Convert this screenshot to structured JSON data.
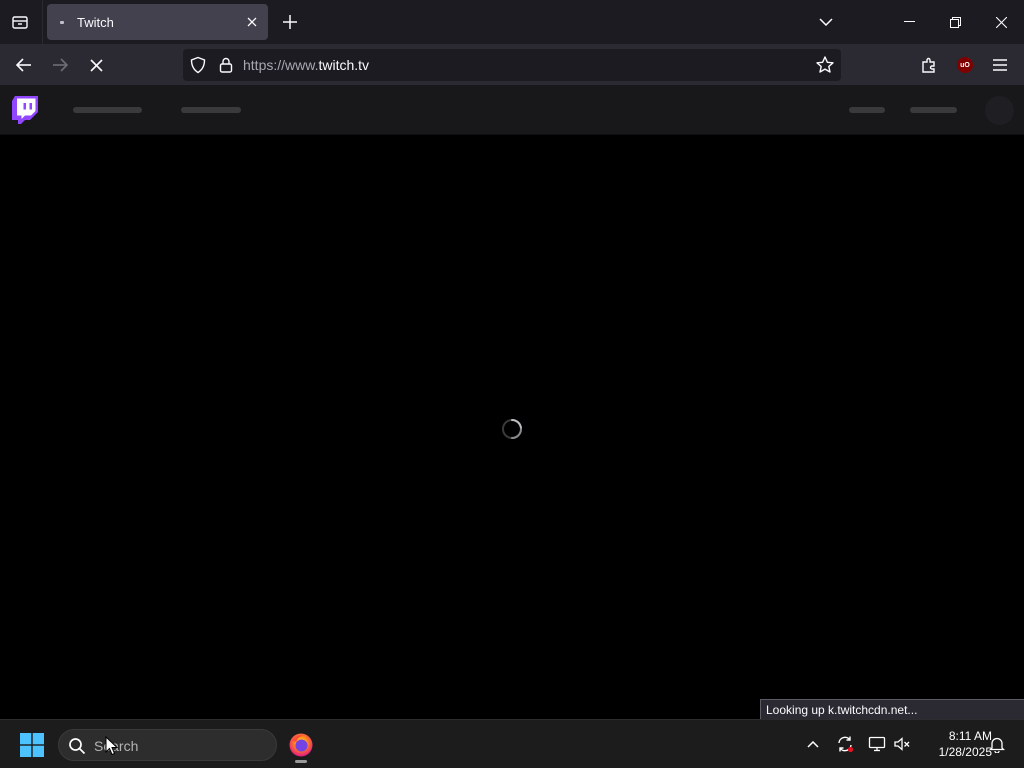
{
  "browser": {
    "tab": {
      "title": "Twitch"
    },
    "url": {
      "prefix": "https://www.",
      "host": "twitch.tv"
    },
    "status_text": "Looking up k.twitchcdn.net...",
    "extension_badge": "uO"
  },
  "icons": {
    "tab_list": "firefox-view-icon",
    "new_tab": "plus-icon",
    "back": "arrow-left-icon",
    "forward": "arrow-right-icon",
    "stop": "close-x-icon",
    "bookmark": "star-icon",
    "menu": "hamburger-icon",
    "loading": "spinner-icon"
  },
  "colors": {
    "twitch_purple": "#9146ff",
    "page_background": "#000000",
    "toolbar": "#2b2a33",
    "tabstrip": "#1c1b22"
  },
  "taskbar": {
    "search_placeholder": "Search",
    "time": "8:11 AM",
    "date": "1/28/2025"
  }
}
